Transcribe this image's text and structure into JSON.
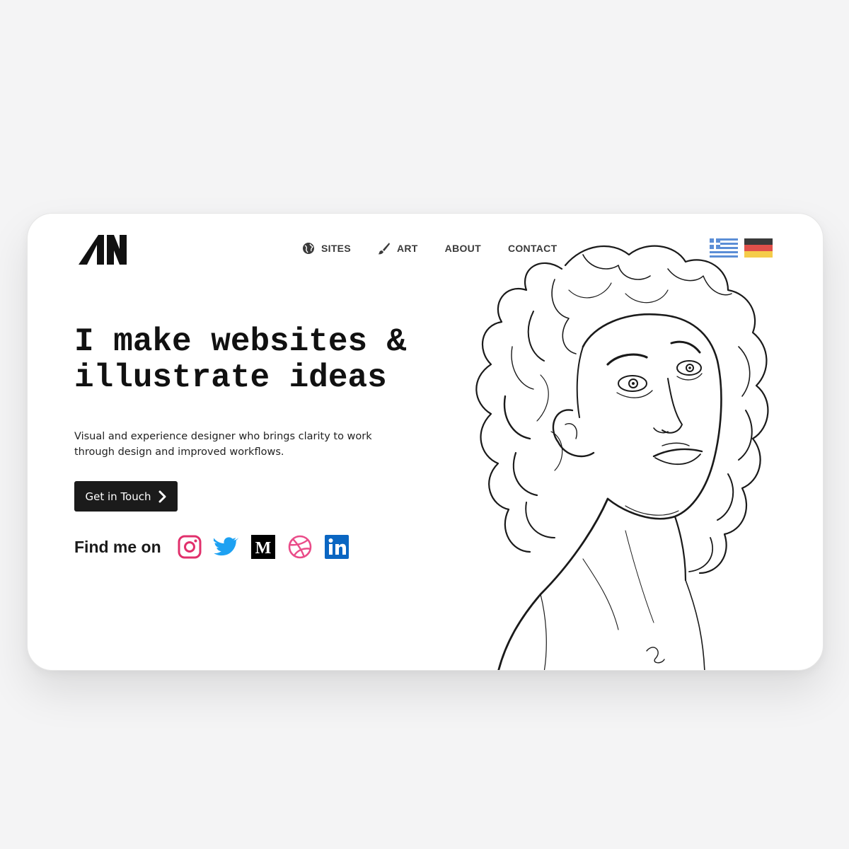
{
  "nav": {
    "items": [
      {
        "label": "SITES",
        "icon": "globe-icon"
      },
      {
        "label": "ART",
        "icon": "brush-icon"
      },
      {
        "label": "ABOUT"
      },
      {
        "label": "CONTACT"
      }
    ]
  },
  "languages": [
    {
      "icon": "greece-flag-icon"
    },
    {
      "icon": "germany-flag-icon"
    }
  ],
  "hero": {
    "headline_line1": "I make websites &",
    "headline_line2": "illustrate ideas",
    "subtitle": "Visual and experience designer who brings clarity to work through design and improved workflows.",
    "cta_label": "Get in Touch",
    "find_label": "Find me on"
  },
  "social": [
    {
      "icon": "instagram-icon",
      "color": "#e1306c"
    },
    {
      "icon": "twitter-icon",
      "color": "#1da1f2"
    },
    {
      "icon": "medium-icon",
      "color": "#000000"
    },
    {
      "icon": "dribbble-icon",
      "color": "#ea4c89"
    },
    {
      "icon": "linkedin-icon",
      "color": "#0a66c2"
    }
  ],
  "colors": {
    "background": "#f4f4f5",
    "card": "#ffffff",
    "text": "#111111",
    "button": "#1b1b1b"
  }
}
